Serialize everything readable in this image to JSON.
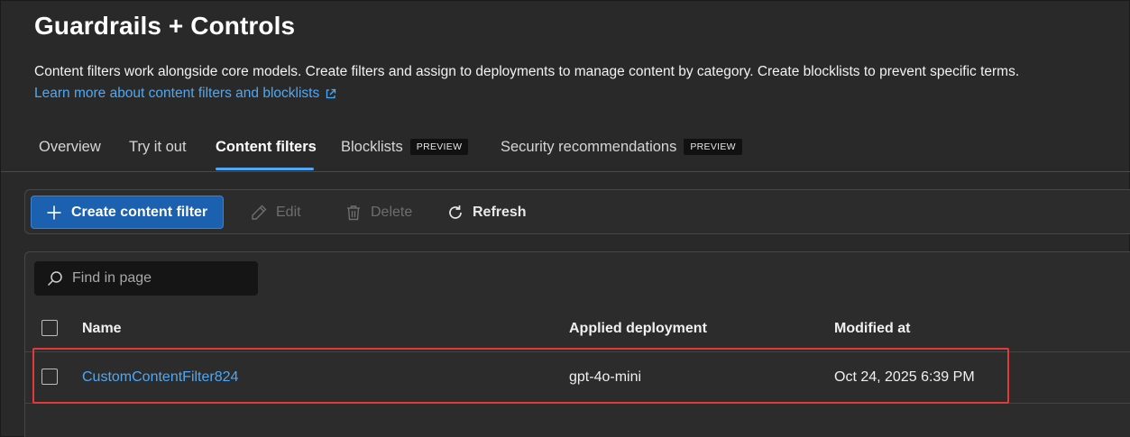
{
  "page": {
    "title": "Guardrails + Controls",
    "description": "Content filters work alongside core models. Create filters and assign to deployments to manage content by category. Create blocklists to prevent specific terms.",
    "learn_link": "Learn more about content filters and blocklists"
  },
  "tabs": [
    {
      "label": "Overview"
    },
    {
      "label": "Try it out"
    },
    {
      "label": "Content filters",
      "active": true
    },
    {
      "label": "Blocklists",
      "badge": "PREVIEW"
    },
    {
      "label": "Security recommendations",
      "badge": "PREVIEW"
    }
  ],
  "toolbar": {
    "create_label": "Create content filter",
    "edit_label": "Edit",
    "delete_label": "Delete",
    "refresh_label": "Refresh"
  },
  "search": {
    "placeholder": "Find in page"
  },
  "table": {
    "columns": [
      "Name",
      "Applied deployment",
      "Modified at"
    ],
    "rows": [
      {
        "name": "CustomContentFilter824",
        "deployment": "gpt-4o-mini",
        "modified": "Oct 24, 2025 6:39 PM"
      }
    ]
  },
  "icons": {
    "external_link": "external-link-icon",
    "plus": "plus-icon",
    "edit": "pencil-icon",
    "delete": "trash-icon",
    "refresh": "refresh-icon",
    "search": "search-icon"
  },
  "colors": {
    "background": "#292929",
    "primary_button": "#1c61b0",
    "link": "#4ea8f5",
    "highlight": "#e2393b"
  }
}
